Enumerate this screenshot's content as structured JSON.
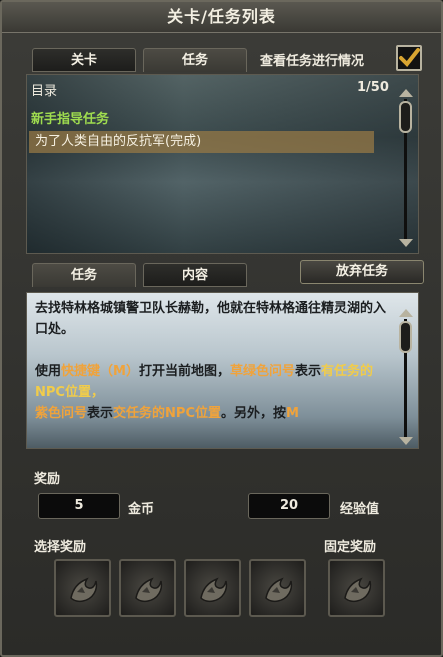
{
  "window": {
    "title": "关卡/任务列表"
  },
  "top_tabs": [
    {
      "label": "关卡"
    },
    {
      "label": "任务"
    }
  ],
  "view_progress": {
    "label": "查看任务进行情况",
    "checked": true
  },
  "list": {
    "header": "目录",
    "count": "1/50",
    "category": "新手指导任务",
    "items": [
      {
        "label": "为了人类自由的反抗军(完成)"
      }
    ]
  },
  "sub_tabs": [
    {
      "label": "任务"
    },
    {
      "label": "内容"
    }
  ],
  "abandon_button": "放弃任务",
  "description": {
    "line1": "去找特林格城镇警卫队长赫勒，他就在特林格通往精灵湖的入口处。",
    "p2_a": "使用",
    "p2_b": "快捷键（M）",
    "p2_c": "打开当前地图，",
    "p2_d": "草绿色问号",
    "p2_e": "表示",
    "p2_f": "有任务的NPC位置，",
    "p2_g": "紫色问号",
    "p2_h": "表示",
    "p2_i": "交任务的NPC位置",
    "p2_j": "。另外，按",
    "p2_k": "M"
  },
  "rewards": {
    "title": "奖励",
    "gold_value": "5",
    "gold_label": "金币",
    "exp_value": "20",
    "exp_label": "经验值",
    "choice_label": "选择奖励",
    "fixed_label": "固定奖励"
  },
  "colors": {
    "green_text": "#9fdc4f",
    "orange_text": "#f0a33b",
    "yellow_text": "#f1cc4a",
    "checkbox": "#d9a531"
  },
  "icons": {
    "reward_slot": "dragon-emblem-icon"
  }
}
